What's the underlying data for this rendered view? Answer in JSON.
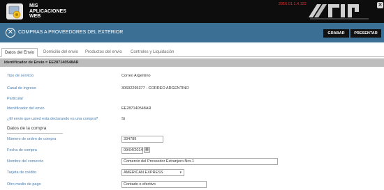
{
  "header": {
    "app_title_line1": "MIS",
    "app_title_line2": "APLICACIONES",
    "app_title_line3": "WEB",
    "version": "2016.01.1.4.122",
    "close_glyph": "✕"
  },
  "titlebar": {
    "icon_glyph": "✕",
    "title": "COMPRAS A PROVEEDORES DEL EXTERIOR",
    "grabar": "GRABAR",
    "presentar": "PRESENTAR"
  },
  "tabs": [
    {
      "label": "Datos del Envio"
    },
    {
      "label": "Domicilio del envio"
    },
    {
      "label": "Productos del envio"
    },
    {
      "label": "Controles y Liquidación"
    }
  ],
  "id_bar": "Identificador de Envio = EE287140548AR",
  "form": {
    "tipo_servicio_label": "Tipo de servicio",
    "tipo_servicio_value": "Correo Argentino",
    "canal_label": "Canal de ingreso",
    "canal_value": "30692295377 - CORREO ARGENTINO",
    "particular_label": "Particular",
    "identificador_label": "Identificador del envio",
    "identificador_value": "EE287140548AR",
    "declarando_label": "¿El envio que usted esta declarando es una compra?",
    "declarando_value": "Si",
    "section_title": "Datos de la compra",
    "orden_label": "Número de orden de compra",
    "orden_value": "334789",
    "fecha_label": "Fecha de compra",
    "fecha_value": "09/04/2014",
    "comercio_label": "Nombre del comercio",
    "comercio_value": "Comercio del Proveedor Extranjero Nro.1",
    "tarjeta_label": "Tarjeta de crédito",
    "tarjeta_value": "AMERICAN EXPRESS",
    "otro_label": "Otro medio de pago",
    "otro_value": "Contado o efectivo"
  }
}
